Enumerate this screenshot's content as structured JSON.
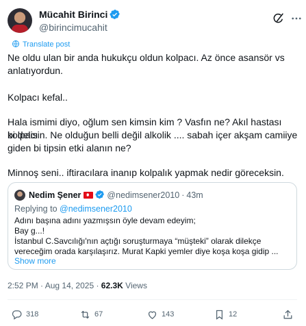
{
  "author": {
    "name": "Mücahit Birinci",
    "handle": "@birincimucahit"
  },
  "translate_label": "Translate post",
  "post_lines": [
    "Ne oldu ulan bir anda hukukçu oldun kolpacı. Az önce asansör vs",
    "anlatıyordun.",
    "Kolpacı kefal..",
    "Hala ismimi diyo, oğlum sen kimsin kim ? Vasfın ne?  Akıl hastası kolpacı",
    "bi delisin. Ne olduğun belli değil alkolik .... sabah içer akşam camiiye",
    "giden bi tipsin etki alanın ne?",
    "Minnoş seni.. iftiracılara inanıp kolpalık yapmak nedir göreceksin."
  ],
  "quote": {
    "name": "Nedim Şener",
    "handle": "@nedimsener2010",
    "time": "43m",
    "reply_prefix": "Replying to ",
    "reply_handle": "@nedimsener2010",
    "lines": [
      "Adını başına adını yazmışsın öyle devam edeyim;",
      "Bay g...!",
      "İstanbul C.Savcılığı'nın açtığı soruşturmaya “müşteki” olarak dilekçe",
      "vereceğim orada karşılaşırız. Murat Kapki yemler diye koşa koşa gidip ..."
    ],
    "show_more": "Show more"
  },
  "meta": {
    "time": "2:52 PM",
    "date": "Aug 14, 2025",
    "views": "62.3K",
    "views_label": "Views"
  },
  "actions": {
    "replies": "318",
    "reposts": "67",
    "likes": "143",
    "bookmarks": "12"
  },
  "colors": {
    "accent": "#1d9bf0",
    "text": "#0f1419",
    "muted": "#536471",
    "border": "#cfd9de"
  }
}
